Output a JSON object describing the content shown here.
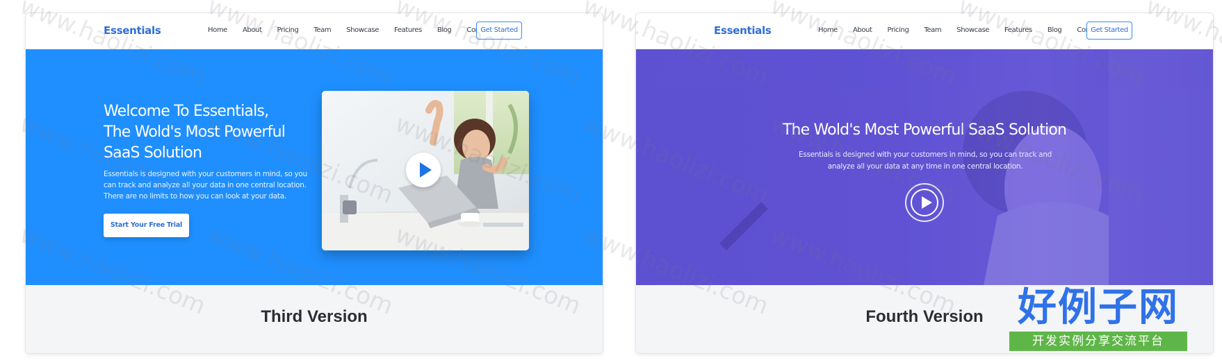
{
  "cards": [
    {
      "brand": "Essentials",
      "nav": [
        "Home",
        "About",
        "Pricing",
        "Team",
        "Showcase",
        "Features",
        "Blog",
        "Contact"
      ],
      "cta_nav": "Get Started",
      "hero": {
        "title_lines": [
          "Welcome To Essentials,",
          "The Wold's Most Powerful",
          "SaaS Solution"
        ],
        "paragraph": "Essentials is designed with your customers in mind, so you can track and analyze all your data in one central location. There are no limits to how you can look at your data.",
        "button": "Start Your Free Trial"
      },
      "caption": "Third Version"
    },
    {
      "brand": "Essentials",
      "nav": [
        "Home",
        "About",
        "Pricing",
        "Team",
        "Showcase",
        "Features",
        "Blog",
        "Contact"
      ],
      "cta_nav": "Get Started",
      "hero": {
        "title": "The Wold's Most Powerful SaaS Solution",
        "paragraph": "Essentials is designed with your customers in mind, so you can track and analyze all your data at any time in one central location."
      },
      "caption": "Fourth Version"
    }
  ],
  "overlay": {
    "title": "好例子网",
    "subtitle": "开发实例分享交流平台"
  },
  "watermark": "www.haolizi.com",
  "colors": {
    "blue_hero": "#1f8fff",
    "purple_hero": "#5a4dcf",
    "brand": "#2f6fd6",
    "overlay_blue": "#2f72e8",
    "overlay_green": "#5fb648"
  }
}
